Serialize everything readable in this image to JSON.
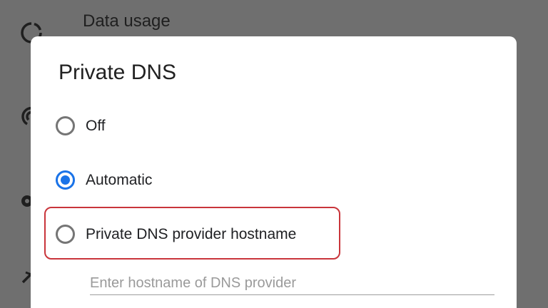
{
  "background_settings": {
    "items": [
      {
        "label": "Data usage",
        "icon": "data-usage-icon"
      },
      {
        "label": "",
        "icon": "hotspot-icon"
      },
      {
        "label": "",
        "icon": "vpn-icon"
      },
      {
        "label": "",
        "icon": "airplane-icon"
      }
    ]
  },
  "dialog": {
    "title": "Private DNS",
    "options": [
      {
        "label": "Off",
        "selected": false
      },
      {
        "label": "Automatic",
        "selected": true
      },
      {
        "label": "Private DNS provider hostname",
        "selected": false,
        "highlighted": true
      }
    ],
    "hostname_input": {
      "value": "",
      "placeholder": "Enter hostname of DNS provider"
    }
  },
  "colors": {
    "accent": "#1a73e8",
    "highlight_outline": "#c9353b",
    "scrim": "#6f6f6f"
  }
}
